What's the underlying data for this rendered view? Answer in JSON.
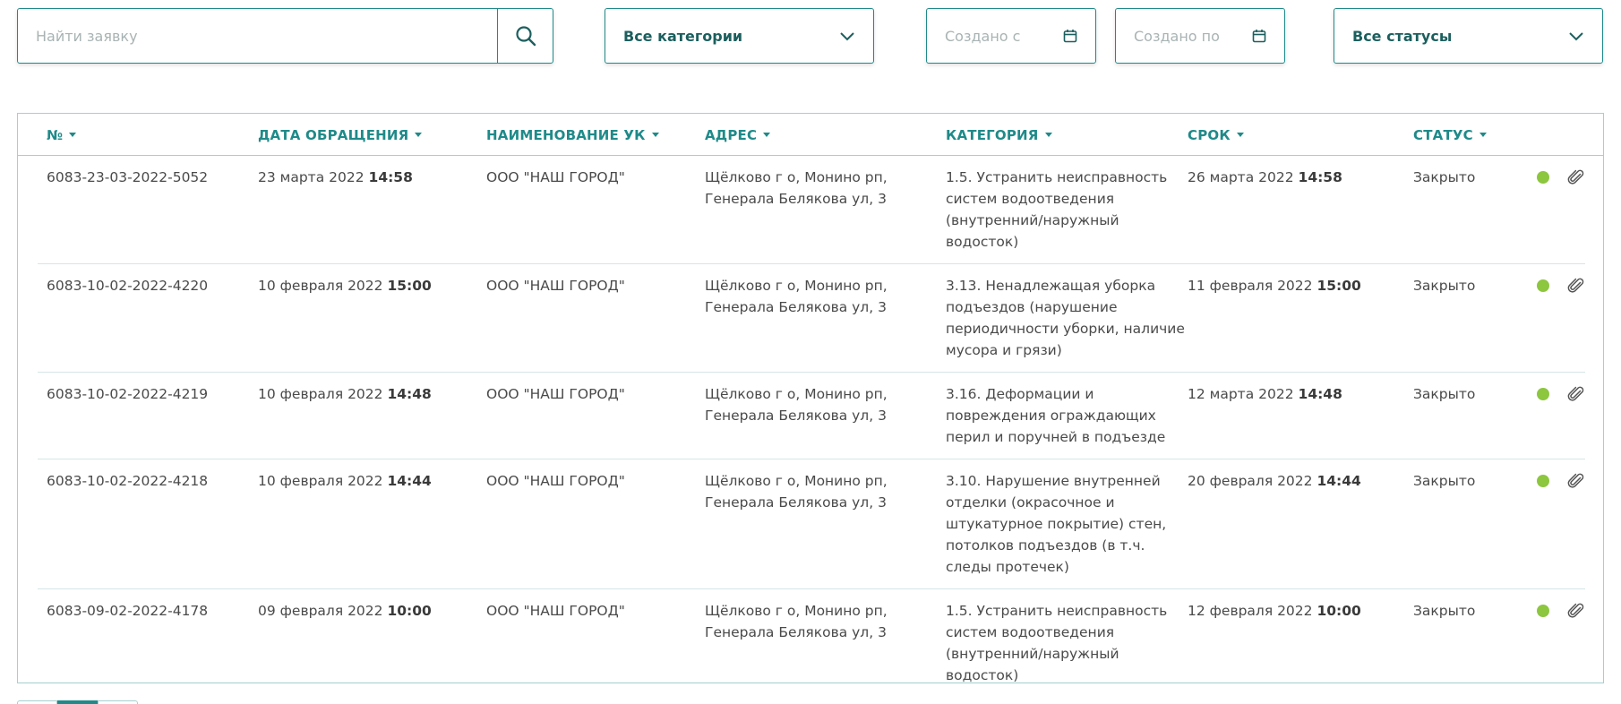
{
  "filters": {
    "search_placeholder": "Найти заявку",
    "category_label": "Все категории",
    "created_from_placeholder": "Создано с",
    "created_to_placeholder": "Создано по",
    "status_label": "Все статусы"
  },
  "table": {
    "headers": [
      "№",
      "ДАТА ОБРАЩЕНИЯ",
      "НАИМЕНОВАНИЕ УК",
      "АДРЕС",
      "КАТЕГОРИЯ",
      "СРОК",
      "СТАТУС"
    ],
    "rows": [
      {
        "number": "6083-23-03-2022-5052",
        "date": "23 марта 2022",
        "date_time": "14:58",
        "company": "ООО \"НАШ ГОРОД\"",
        "address": [
          "Щёлково г о, Монино рп,",
          "Генерала Белякова ул, 3"
        ],
        "category": [
          "1.5. Устранить неисправность",
          "систем водоотведения",
          "(внутренний/наружный",
          "водосток)"
        ],
        "deadline": "26 марта 2022",
        "deadline_time": "14:58",
        "status": "Закрыто"
      },
      {
        "number": "6083-10-02-2022-4220",
        "date": "10 февраля 2022",
        "date_time": "15:00",
        "company": "ООО \"НАШ ГОРОД\"",
        "address": [
          "Щёлково г о, Монино рп,",
          "Генерала Белякова ул, 3"
        ],
        "category": [
          "3.13. Ненадлежащая уборка",
          "подъездов (нарушение",
          "периодичности уборки, наличие",
          "мусора и грязи)"
        ],
        "deadline": "11 февраля 2022",
        "deadline_time": "15:00",
        "status": "Закрыто"
      },
      {
        "number": "6083-10-02-2022-4219",
        "date": "10 февраля 2022",
        "date_time": "14:48",
        "company": "ООО \"НАШ ГОРОД\"",
        "address": [
          "Щёлково г о, Монино рп,",
          "Генерала Белякова ул, 3"
        ],
        "category": [
          "3.16. Деформации и",
          "повреждения ограждающих",
          "перил и поручней в подъезде"
        ],
        "deadline": "12 марта 2022",
        "deadline_time": "14:48",
        "status": "Закрыто"
      },
      {
        "number": "6083-10-02-2022-4218",
        "date": "10 февраля 2022",
        "date_time": "14:44",
        "company": "ООО \"НАШ ГОРОД\"",
        "address": [
          "Щёлково г о, Монино рп,",
          "Генерала Белякова ул, 3"
        ],
        "category": [
          "3.10. Нарушение внутренней",
          "отделки (окрасочное и",
          "штукатурное покрытие) стен,",
          "потолков подъездов (в т.ч.",
          "следы протечек)"
        ],
        "deadline": "20 февраля 2022",
        "deadline_time": "14:44",
        "status": "Закрыто"
      },
      {
        "number": "6083-09-02-2022-4178",
        "date": "09 февраля 2022",
        "date_time": "10:00",
        "company": "ООО \"НАШ ГОРОД\"",
        "address": [
          "Щёлково г о, Монино рп,",
          "Генерала Белякова ул, 3"
        ],
        "category": [
          "1.5. Устранить неисправность",
          "систем водоотведения",
          "(внутренний/наружный",
          "водосток)"
        ],
        "deadline": "12 февраля 2022",
        "deadline_time": "10:00",
        "status": "Закрыто"
      }
    ]
  },
  "icons": {
    "search": "search-icon",
    "chevron": "chevron-down-icon",
    "calendar": "calendar-icon",
    "status_dot": "status-dot-icon",
    "attachment": "paperclip-icon"
  },
  "colors": {
    "accent": "#1f8a89",
    "header_text": "#1f8a89",
    "select_text": "#1c5f5e",
    "status_closed": "#8dc63f",
    "border": "#a6cfcf"
  }
}
